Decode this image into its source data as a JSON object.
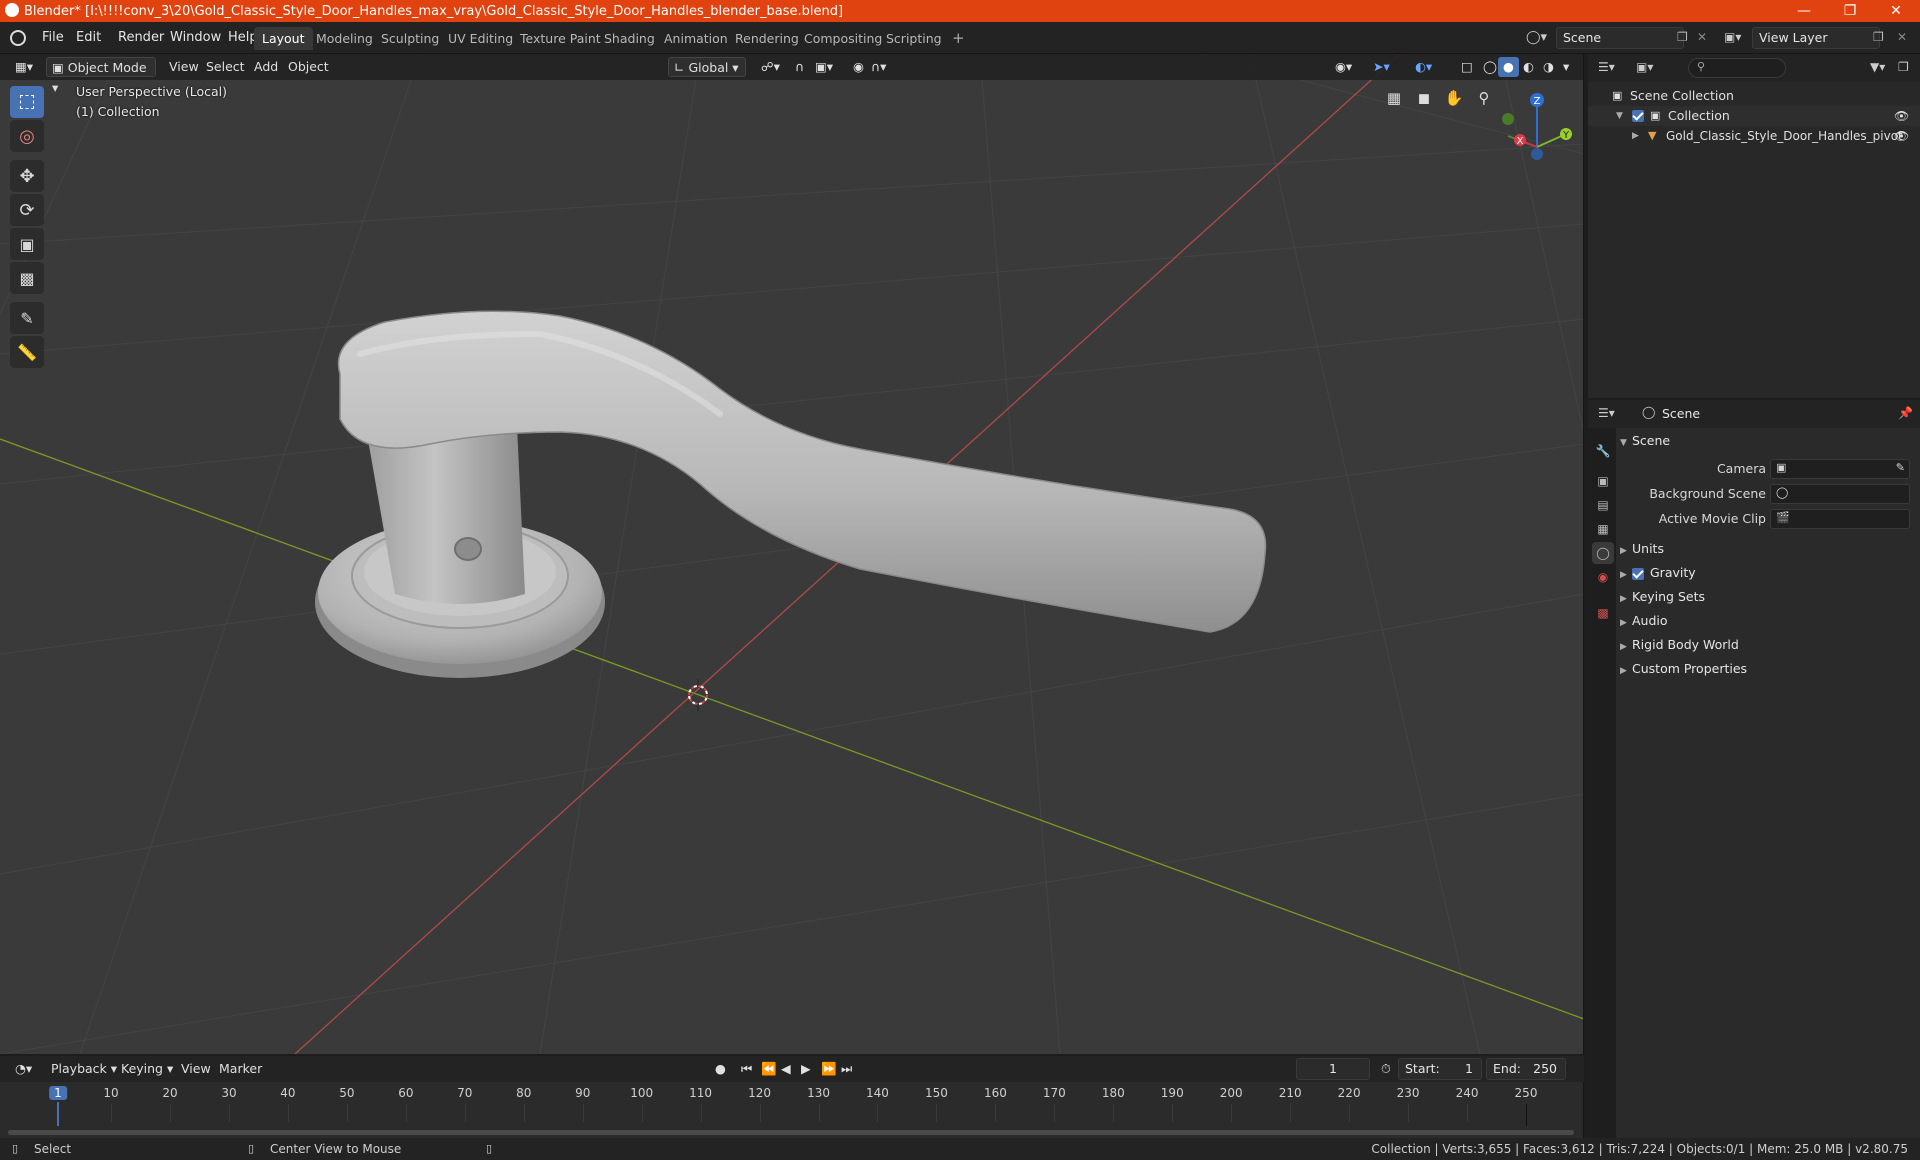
{
  "window": {
    "title": "Blender* [I:\\!!!!conv_3\\20\\Gold_Classic_Style_Door_Handles_max_vray\\Gold_Classic_Style_Door_Handles_blender_base.blend]"
  },
  "menu": [
    "File",
    "Edit",
    "Render",
    "Window",
    "Help"
  ],
  "workspaces": {
    "tabs": [
      "Layout",
      "Modeling",
      "Sculpting",
      "UV Editing",
      "Texture Paint",
      "Shading",
      "Animation",
      "Rendering",
      "Compositing",
      "Scripting"
    ],
    "active": "Layout",
    "add_glyph": "+"
  },
  "scene_selector": {
    "value": "Scene"
  },
  "view_layer_selector": {
    "value": "View Layer"
  },
  "viewport_header": {
    "mode": "Object Mode",
    "view": "View",
    "select": "Select",
    "add": "Add",
    "object": "Object",
    "orientation": "Global"
  },
  "viewport": {
    "perspective_label": "User Perspective (Local)",
    "collection_label": "(1) Collection",
    "colors": {
      "x_axis": "#b04a4a",
      "y_axis": "#7a9a23",
      "grid": "#434343",
      "background": "#3a3a3a"
    },
    "gizmo": {
      "x": "X",
      "y": "Y",
      "z": "Z"
    }
  },
  "outliner": {
    "root": "Scene Collection",
    "collection": "Collection",
    "object": "Gold_Classic_Style_Door_Handles_pivot"
  },
  "properties": {
    "context": "Scene",
    "panel_title": "Scene",
    "fields": {
      "camera": "Camera",
      "background_scene": "Background Scene",
      "active_movie_clip": "Active Movie Clip"
    },
    "sections": {
      "units": "Units",
      "gravity": "Gravity",
      "keying_sets": "Keying Sets",
      "audio": "Audio",
      "rigid_body_world": "Rigid Body World",
      "custom_properties": "Custom Properties"
    }
  },
  "timeline": {
    "playback": "Playback",
    "keying": "Keying",
    "view": "View",
    "marker": "Marker",
    "current_frame": "1",
    "start_label": "Start:",
    "start": "1",
    "end_label": "End:",
    "end": "250",
    "ticks": [
      "1",
      "10",
      "20",
      "30",
      "40",
      "50",
      "60",
      "70",
      "80",
      "90",
      "100",
      "110",
      "120",
      "130",
      "140",
      "150",
      "160",
      "170",
      "180",
      "190",
      "200",
      "210",
      "220",
      "230",
      "240",
      "250"
    ]
  },
  "statusbar": {
    "select": "Select",
    "center_view": "Center View to Mouse",
    "stats": "Collection | Verts:3,655 | Faces:3,612 | Tris:7,224 | Objects:0/1 | Mem: 25.0 MB | v2.80.75"
  }
}
